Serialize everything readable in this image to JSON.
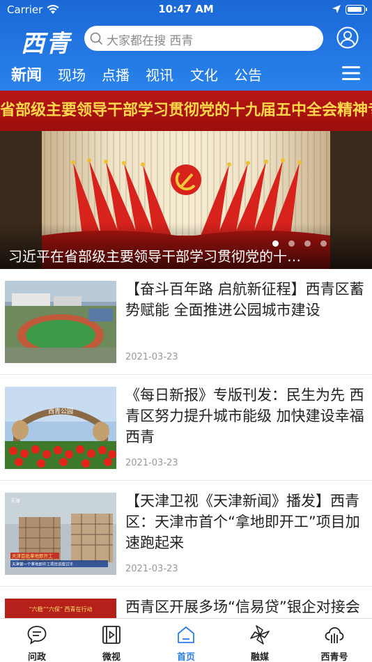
{
  "status_bar": {
    "carrier": "Carrier",
    "time": "10:47 AM"
  },
  "header": {
    "logo": "西青",
    "search_placeholder": "大家都在搜 西青"
  },
  "tabs": [
    {
      "label": "新闻",
      "active": true
    },
    {
      "label": "现场",
      "active": false
    },
    {
      "label": "点播",
      "active": false
    },
    {
      "label": "视讯",
      "active": false
    },
    {
      "label": "文化",
      "active": false
    },
    {
      "label": "公告",
      "active": false
    }
  ],
  "banner": {
    "slogan": "省部级主要领导干部学习贯彻党的十九届五中全会精神专题研讨班",
    "caption": "习近平在省部级主要领导干部学习贯彻党的十…",
    "slide_count": 4,
    "active_slide": 1
  },
  "news": [
    {
      "title": "【奋斗百年路 启航新征程】西青区蓄势赋能 全面推进公园城市建设",
      "date": "2021-03-23"
    },
    {
      "title": "《每日新报》专版刊发：民生为先 西青区努力提升城市能级 加快建设幸福西青",
      "date": "2021-03-23"
    },
    {
      "title": "【天津卫视《天津新闻》播发】西青区：天津市首个“拿地即开工”项目加速跑起来",
      "date": "2021-03-23"
    },
    {
      "title": "西青区开展多场“信易贷”银企对接会",
      "date": ""
    }
  ],
  "thumb_texts": {
    "park_gate": "西青公园",
    "tv_headline": "天津首批拿地即开工",
    "tv_subline": "天津第一个拿地即开工项目进度过半",
    "tv_logo": "天津",
    "banner4": "“六稳”“六保” 西青在行动"
  },
  "tabbar": [
    {
      "label": "问政",
      "icon": "chat-icon",
      "active": false
    },
    {
      "label": "微视",
      "icon": "video-icon",
      "active": false
    },
    {
      "label": "首页",
      "icon": "home-icon",
      "active": true
    },
    {
      "label": "融媒",
      "icon": "pinwheel-icon",
      "active": false
    },
    {
      "label": "西青号",
      "icon": "cloud-icon",
      "active": false
    }
  ],
  "colors": {
    "brand_blue": "#2a7ce6",
    "header_blue": "#1f72df"
  }
}
